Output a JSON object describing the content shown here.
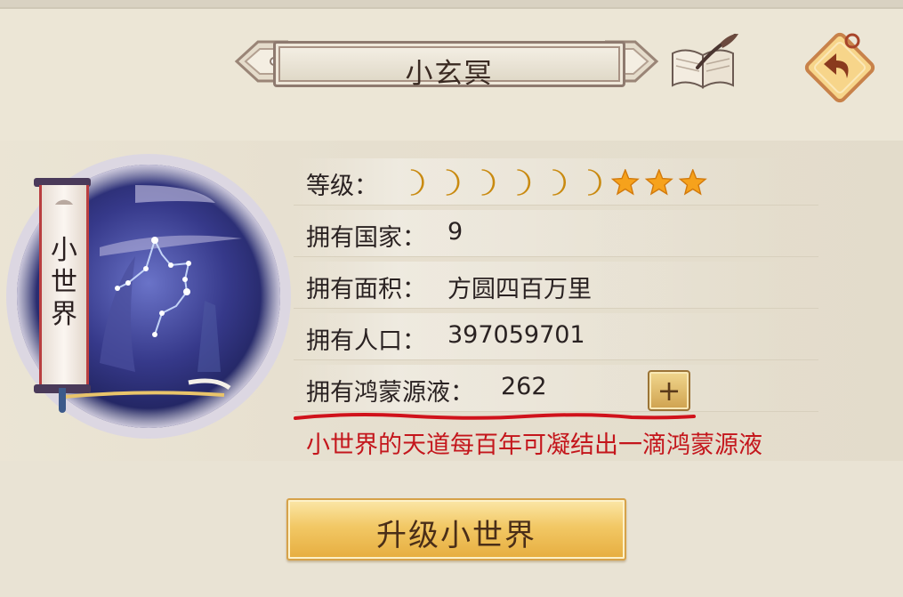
{
  "header": {
    "title": "小玄冥"
  },
  "icons": {
    "book": "book-quill-icon",
    "back": "back-arrow-icon"
  },
  "world_badge": {
    "label_lines": [
      "小",
      "世",
      "界"
    ]
  },
  "info": {
    "level_label": "等级：",
    "level_moons": 6,
    "level_stars": 3,
    "country_label": "拥有国家：",
    "country_value": "9",
    "area_label": "拥有面积：",
    "area_value": "方圆四百万里",
    "population_label": "拥有人口：",
    "population_value": "397059701",
    "liquid_label": "拥有鸿蒙源液：",
    "liquid_value": "262",
    "add_label": "+"
  },
  "note": "小世界的天道每百年可凝结出一滴鸿蒙源液",
  "upgrade_button": "升级小世界",
  "colors": {
    "background": "#ece6d6",
    "note_red": "#c4161c",
    "button_gold": "#f2c865",
    "moon_gold": "#f3b21e"
  }
}
